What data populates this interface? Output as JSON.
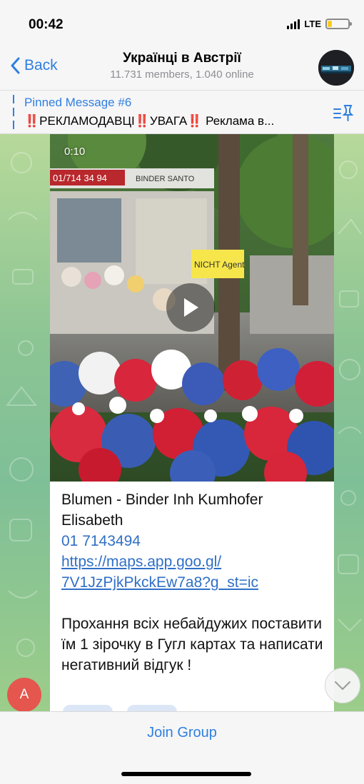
{
  "status_bar": {
    "time": "00:42",
    "network": "LTE",
    "battery_percent": 20
  },
  "header": {
    "back_label": "Back",
    "title": "Українці в Австрії",
    "subtitle": "11.731 members, 1.040 online"
  },
  "pinned": {
    "title": "Pinned Message #6",
    "text": "‼️РЕКЛАМОДАВЦІ‼️УВАГА‼️ Реклама в..."
  },
  "message": {
    "video_duration": "0:10",
    "name_line": "Blumen - Binder Inh Kumhofer Elisabeth",
    "phone": "01 7143494",
    "url_line1": "https://maps.app.goo.gl/",
    "url_line2": "7V1JzPjkPkckEw7a8?g_st=ic",
    "body": "Прохання всіх небайдужих поставити їм 1 зірочку в Гугл картах та написати негативний відгук !",
    "sender_initial": "A"
  },
  "sign": {
    "kiosk_phone": "01/714 34 94",
    "kiosk_name": "BINDER SANTO",
    "paper_sign": "NICHT Agent"
  },
  "footer": {
    "join_label": "Join Group"
  },
  "colors": {
    "accent": "#2f7fe0",
    "link": "#2f6fc6",
    "badge": "#e5564e"
  },
  "icons": [
    "chevron-left-icon",
    "group-avatar-icon",
    "unpin-list-icon",
    "play-icon",
    "chevron-down-icon"
  ]
}
